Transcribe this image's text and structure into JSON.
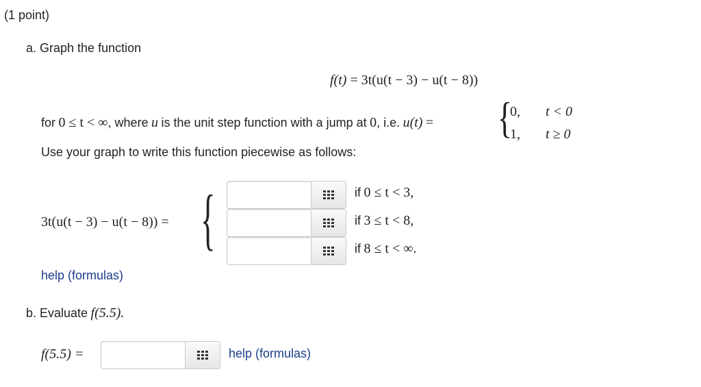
{
  "header": {
    "points": "(1 point)"
  },
  "part_a": {
    "label": "a. Graph the function",
    "equation": {
      "lhs": "f(t)",
      "eq": "=",
      "rhs": "3t(u(t − 3) − u(t − 8))"
    },
    "desc_prefix": "for",
    "domain": "0 ≤ t < ∞",
    "desc_mid": ", where",
    "u_var": "u",
    "desc_after": "is the unit step function with a jump at",
    "jump_point": "0",
    "ie": ", i.e.",
    "ut": "u(t)",
    "ut_eq": "=",
    "piece_u": [
      {
        "value": "0,",
        "cond": "t < 0"
      },
      {
        "value": "1,",
        "cond": "t ≥ 0"
      }
    ],
    "instruction": "Use your graph to write this function piecewise as follows:",
    "piecewise_lhs": "3t(u(t − 3) − u(t − 8)) =",
    "rows": [
      {
        "value": "",
        "placeholder": "",
        "cond_prefix": "if",
        "cond": "0 ≤ t < 3",
        "cond_suffix": ","
      },
      {
        "value": "",
        "placeholder": "",
        "cond_prefix": "if",
        "cond": "3 ≤ t < 8",
        "cond_suffix": ","
      },
      {
        "value": "",
        "placeholder": "",
        "cond_prefix": "if",
        "cond": "8 ≤ t < ∞",
        "cond_suffix": "."
      }
    ],
    "help_link": "help (formulas)"
  },
  "part_b": {
    "label_prefix": "b. Evaluate",
    "label_math": "f(5.5).",
    "lhs": "f(5.5) =",
    "answer": {
      "value": "",
      "placeholder": ""
    },
    "help_link": "help (formulas)"
  },
  "icons": {
    "grid": "grid-icon"
  }
}
